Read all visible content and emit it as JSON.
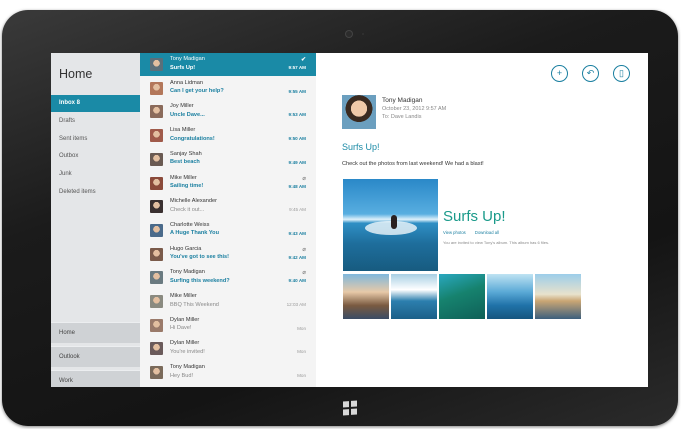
{
  "app": {
    "title": "Home"
  },
  "folders": [
    {
      "label": "Inbox  8",
      "selected": true
    },
    {
      "label": "Drafts"
    },
    {
      "label": "Sent items"
    },
    {
      "label": "Outbox"
    },
    {
      "label": "Junk"
    },
    {
      "label": "Deleted items"
    }
  ],
  "accounts": [
    {
      "label": "Home"
    },
    {
      "label": "Outlook"
    },
    {
      "label": "Work"
    }
  ],
  "messages": [
    {
      "from": "Tony Madigan",
      "subject": "Surfs Up!",
      "time": "9:57 AM",
      "unread": true,
      "selected": true,
      "icon": "check-icon",
      "icon_glyph": "✔"
    },
    {
      "from": "Anna Lidman",
      "subject": "Can I get your help?",
      "time": "9:55 AM",
      "unread": true
    },
    {
      "from": "Joy Miller",
      "subject": "Uncle Dave...",
      "time": "9:53 AM",
      "unread": true
    },
    {
      "from": "Lisa Miller",
      "subject": "Congratulations!",
      "time": "9:50 AM",
      "unread": true
    },
    {
      "from": "Sanjay Shah",
      "subject": "Best beach",
      "time": "9:49 AM",
      "unread": true
    },
    {
      "from": "Mike Miller",
      "subject": "Sailing time!",
      "time": "9:48 AM",
      "unread": true,
      "icon": "paperclip-icon",
      "icon_glyph": "⌀"
    },
    {
      "from": "Michelle Alexander",
      "subject": "Check it out...",
      "time": "9:45 AM",
      "unread": false
    },
    {
      "from": "Charlotte Weiss",
      "subject": "A Huge Thank You",
      "time": "9:43 AM",
      "unread": true
    },
    {
      "from": "Hugo Garcia",
      "subject": "You've got to see this!",
      "time": "9:42 AM",
      "unread": true,
      "icon": "paperclip-icon",
      "icon_glyph": "⌀"
    },
    {
      "from": "Tony Madigan",
      "subject": "Surfing this weekend?",
      "time": "9:40 AM",
      "unread": true,
      "icon": "paperclip-icon",
      "icon_glyph": "⌀"
    },
    {
      "from": "Mike Miller",
      "subject": "BBQ This Weekend",
      "time": "12:03 AM",
      "unread": false
    },
    {
      "from": "Dylan Miller",
      "subject": "Hi Dave!",
      "time": "Mon",
      "unread": false
    },
    {
      "from": "Dylan Miller",
      "subject": "You're invited!",
      "time": "Mon",
      "unread": false
    },
    {
      "from": "Tony Madigan",
      "subject": "Hey Bud!",
      "time": "Mon",
      "unread": false
    }
  ],
  "reading": {
    "from": "Tony Madigan",
    "date": "October 23, 2012  9:57 AM",
    "to": "To: Dave Landis",
    "subject": "Surfs Up!",
    "body": "Check out the photos from last weekend! We had a blast!",
    "album_title": "Surfs Up!",
    "album_links": [
      "View photos",
      "Download all"
    ],
    "album_note": "You are invited to view Tony's album. This album has 6 files.",
    "commands": [
      {
        "name": "new-mail-button",
        "glyph": "+"
      },
      {
        "name": "reply-button",
        "glyph": "↶"
      },
      {
        "name": "delete-button",
        "glyph": "▯"
      }
    ]
  },
  "colors": {
    "accent": "#1a8aa6",
    "link": "#1a7fa0",
    "album_title": "#1a9a8a",
    "folder_pane": "#e4e6e8",
    "list_pane": "#f4f4f4"
  }
}
